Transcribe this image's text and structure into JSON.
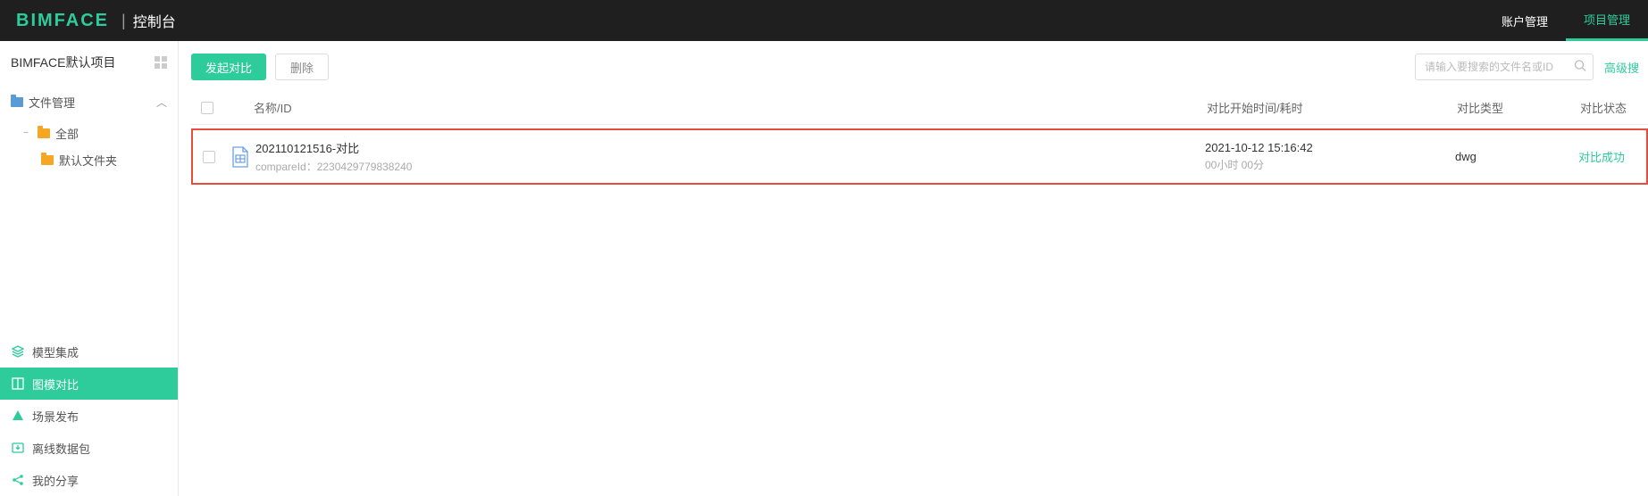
{
  "header": {
    "logo_main": "BIMFACE",
    "logo_sub": "控制台",
    "nav": [
      {
        "label": "账户管理"
      },
      {
        "label": "项目管理"
      }
    ]
  },
  "sidebar": {
    "project_title": "BIMFACE默认项目",
    "file_mgmt_label": "文件管理",
    "tree": {
      "root_label": "全部",
      "child_label": "默认文件夹"
    },
    "nav": [
      {
        "label": "模型集成"
      },
      {
        "label": "图模对比"
      },
      {
        "label": "场景发布"
      },
      {
        "label": "离线数据包"
      },
      {
        "label": "我的分享"
      }
    ]
  },
  "toolbar": {
    "start_compare": "发起对比",
    "delete": "删除",
    "search_placeholder": "请输入要搜索的文件名或ID",
    "advanced_search": "高级搜"
  },
  "table": {
    "head": {
      "name": "名称/ID",
      "time": "对比开始时间/耗时",
      "type": "对比类型",
      "status": "对比状态"
    },
    "row": {
      "name": "202110121516-对比",
      "compare_id_label": "compareId：",
      "compare_id": "2230429779838240",
      "start_time": "2021-10-12 15:16:42",
      "duration": "00小时 00分",
      "type": "dwg",
      "status": "对比成功"
    }
  }
}
